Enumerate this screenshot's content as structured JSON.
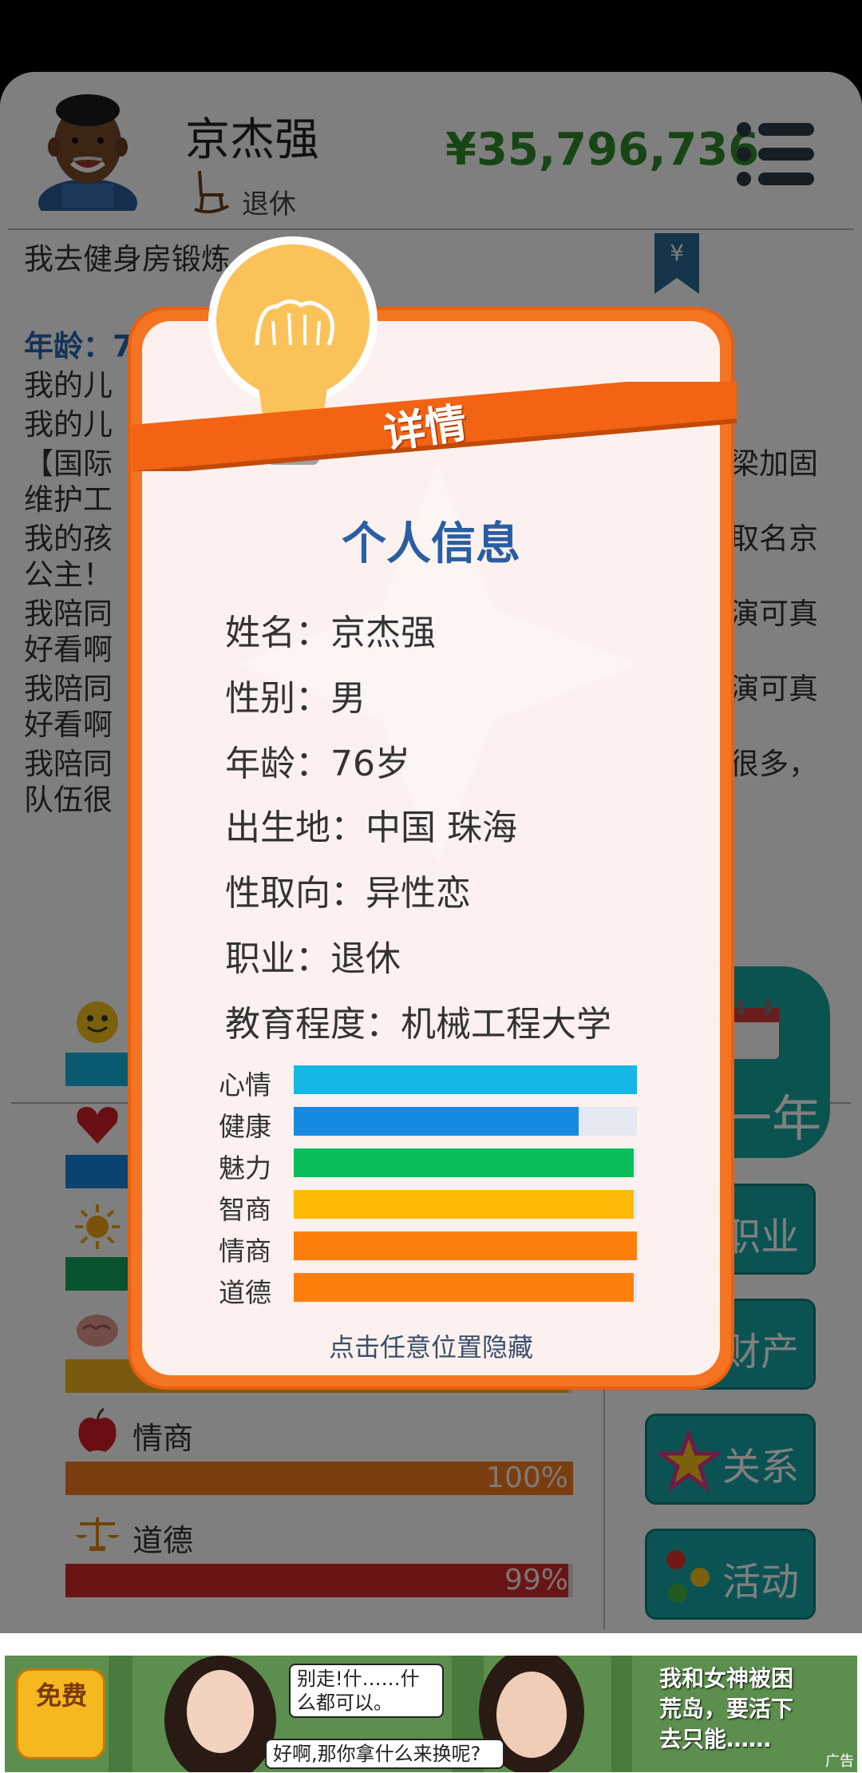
{
  "header": {
    "player_name": "京杰强",
    "job": "退休",
    "money": "¥35,796,736"
  },
  "log": {
    "entries": [
      "我去健身房锻炼",
      "年龄：7",
      "我的儿",
      "我的儿",
      "【国际",
      "梁加固",
      "维护工",
      "我的孩",
      "取名京",
      "公主！",
      "我陪同",
      "演可真",
      "好看啊",
      "我陪同",
      "演可真",
      "好看啊",
      "我陪同",
      "很多，",
      "队伍很"
    ]
  },
  "stats": [
    {
      "name": "心情",
      "value": 1.0,
      "color": "#13b5e0",
      "icon": "smiley-icon"
    },
    {
      "name": "健康",
      "value": 0.83,
      "color": "#1686e0",
      "icon": "heart-icon"
    },
    {
      "name": "魅力",
      "value": 0.99,
      "color": "#10a65a",
      "icon": "sun-icon"
    },
    {
      "name": "智商",
      "value": 0.99,
      "color": "#f6b51f",
      "icon": "brain-icon"
    },
    {
      "name": "情商",
      "value": 1.0,
      "display": "100%",
      "color": "#f47b20",
      "icon": "apple-icon"
    },
    {
      "name": "道德",
      "value": 0.99,
      "display": "99%",
      "color": "#d42a2a",
      "icon": "scales-icon"
    }
  ],
  "side_buttons": {
    "next_year": "一年",
    "career": "职业",
    "assets": "财产",
    "relations": "关系",
    "activities": "活动"
  },
  "popup": {
    "ribbon": "详情",
    "title": "个人信息",
    "name_row": "姓名：京杰强",
    "gender_row": "性别：男",
    "age_row": "年龄：76岁",
    "birthplace_row": "出生地：中国 珠海",
    "orientation_row": "性取向：异性恋",
    "job_row": "职业：退休",
    "education_row": "教育程度：机械工程大学",
    "bars": [
      {
        "label": "心情",
        "value": 1.0,
        "color": "#16b7e4"
      },
      {
        "label": "健康",
        "value": 0.83,
        "color": "#1689e3"
      },
      {
        "label": "魅力",
        "value": 0.99,
        "color": "#08bf5b"
      },
      {
        "label": "智商",
        "value": 0.99,
        "color": "#ffba08"
      },
      {
        "label": "情商",
        "value": 1.0,
        "color": "#ff7f0e"
      },
      {
        "label": "道德",
        "value": 0.99,
        "color": "#ff7f0e"
      }
    ],
    "hint": "点击任意位置隐藏"
  },
  "ad": {
    "badge": "免费",
    "bubble_top": "别走!什……什么都可以。",
    "bubble_bottom": "好啊,那你拿什么来换呢?",
    "right_text_1": "我和女神被困",
    "right_text_2": "荒岛，要活下",
    "right_text_3": "去只能……",
    "tag": "广告"
  },
  "colors": {
    "money": "#2f8a2a",
    "popup_frame": "#f47422",
    "title_blue": "#2a5ea3",
    "teal_button": "#16a7a6"
  }
}
